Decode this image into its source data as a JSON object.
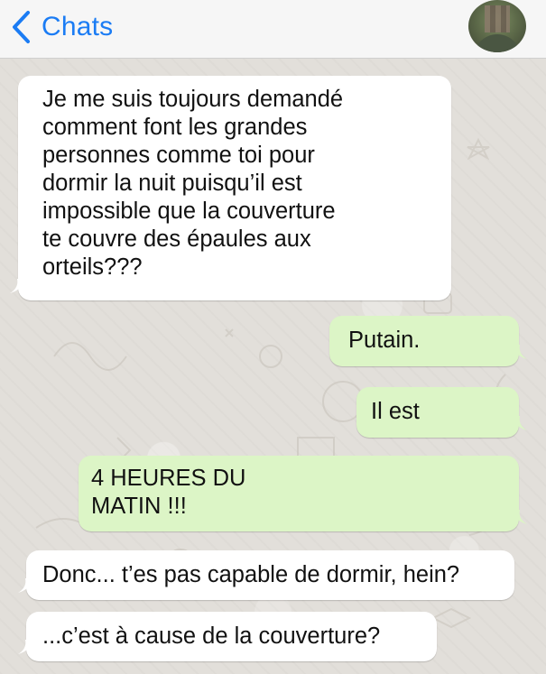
{
  "header": {
    "back_label": "Chats",
    "back_icon": "chevron-left-icon",
    "accent_color": "#1b7cf4"
  },
  "messages": [
    {
      "direction": "incoming",
      "text": "Je me suis toujours demandé\ncomment font les grandes\npersonnes comme toi pour\ndormir la nuit puisqu’il est\nimpossible que la couverture\nte couvre des épaules aux\norteils???"
    },
    {
      "direction": "outgoing",
      "text": "Putain."
    },
    {
      "direction": "outgoing",
      "text": "Il est"
    },
    {
      "direction": "outgoing",
      "text": "4 HEURES DU\nMATIN !!!"
    },
    {
      "direction": "incoming",
      "text": "Donc... t’es pas capable de dormir, hein?"
    },
    {
      "direction": "incoming",
      "text": "...c’est à cause de la couverture?"
    }
  ],
  "colors": {
    "incoming_bubble": "#ffffff",
    "outgoing_bubble": "#dcf5c6",
    "chat_background": "#e2dfda"
  }
}
